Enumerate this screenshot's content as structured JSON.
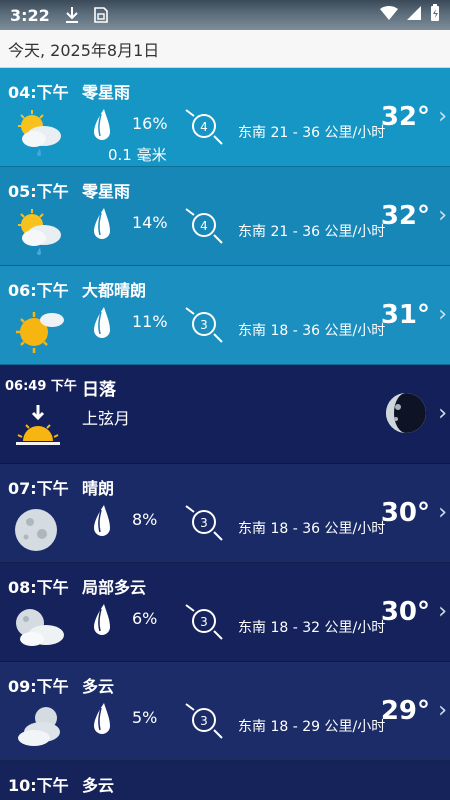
{
  "status": {
    "time": "3:22",
    "icons": [
      "download-icon",
      "sim-card-icon",
      "wifi-icon",
      "signal-icon",
      "battery-icon"
    ]
  },
  "header": {
    "date": "今天, 2025年8月1日"
  },
  "colors": {
    "day_bg": "#1596c4",
    "night_bg": "#1a2a66",
    "sunset_bg": "#14205a"
  },
  "rows": [
    {
      "hour": "04:下午",
      "condition": "零星雨",
      "icon": "sun-cloud-rain-icon",
      "precip": "16%",
      "amount": "0.1 毫米",
      "wind_level": "4",
      "wind": "东南 21 - 36 公里/小时",
      "temp": "32°"
    },
    {
      "hour": "05:下午",
      "condition": "零星雨",
      "icon": "sun-cloud-rain-icon",
      "precip": "14%",
      "amount": "",
      "wind_level": "4",
      "wind": "东南 21 - 36 公里/小时",
      "temp": "32°"
    },
    {
      "hour": "06:下午",
      "condition": "大都晴朗",
      "icon": "sun-small-cloud-icon",
      "precip": "11%",
      "amount": "",
      "wind_level": "3",
      "wind": "东南 18 - 36 公里/小时",
      "temp": "31°"
    },
    {
      "hour": "06:49 下午",
      "condition": "日落",
      "phase": "上弦月",
      "icon": "sunset-icon",
      "moon_icon": "moon-phase-icon"
    },
    {
      "hour": "07:下午",
      "condition": "晴朗",
      "icon": "moon-icon",
      "precip": "8%",
      "amount": "",
      "wind_level": "3",
      "wind": "东南 18 - 36 公里/小时",
      "temp": "30°"
    },
    {
      "hour": "08:下午",
      "condition": "局部多云",
      "icon": "moon-cloud-icon",
      "precip": "6%",
      "amount": "",
      "wind_level": "3",
      "wind": "东南 18 - 32 公里/小时",
      "temp": "30°"
    },
    {
      "hour": "09:下午",
      "condition": "多云",
      "icon": "moon-clouds-icon",
      "precip": "5%",
      "amount": "",
      "wind_level": "3",
      "wind": "东南 18 - 29 公里/小时",
      "temp": "29°"
    },
    {
      "hour": "10:下午",
      "condition": "多云"
    }
  ]
}
